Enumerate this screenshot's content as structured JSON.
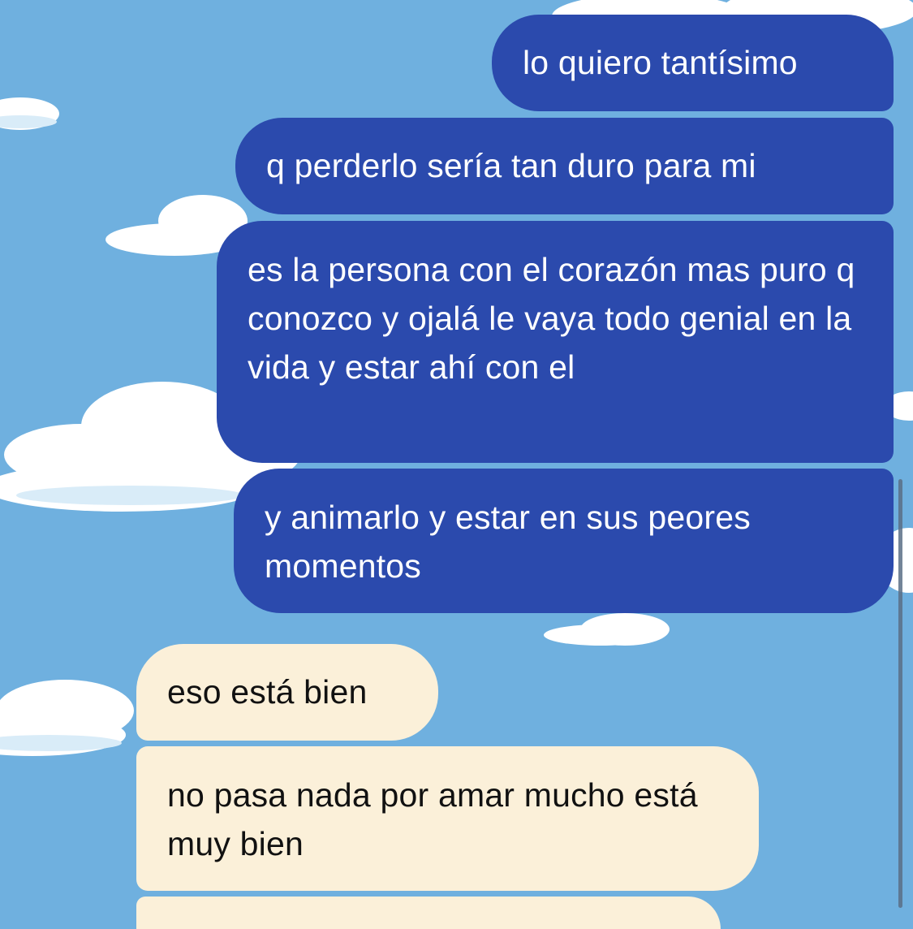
{
  "theme": {
    "background": "#6fb0df",
    "outgoing_bubble": "#2b4aad",
    "incoming_bubble": "#fbf0d9"
  },
  "messages": [
    {
      "direction": "outgoing",
      "text": "lo quiero tantísimo"
    },
    {
      "direction": "outgoing",
      "text": "q perderlo sería tan duro para mi"
    },
    {
      "direction": "outgoing",
      "text": "es la persona con el corazón mas puro q conozco y ojalá le vaya todo genial en la vida y estar ahí con el"
    },
    {
      "direction": "outgoing",
      "text": "y animarlo y estar en sus peores momentos"
    },
    {
      "direction": "incoming",
      "text": "eso está bien"
    },
    {
      "direction": "incoming",
      "text": "no pasa nada por amar mucho está muy bien"
    }
  ]
}
